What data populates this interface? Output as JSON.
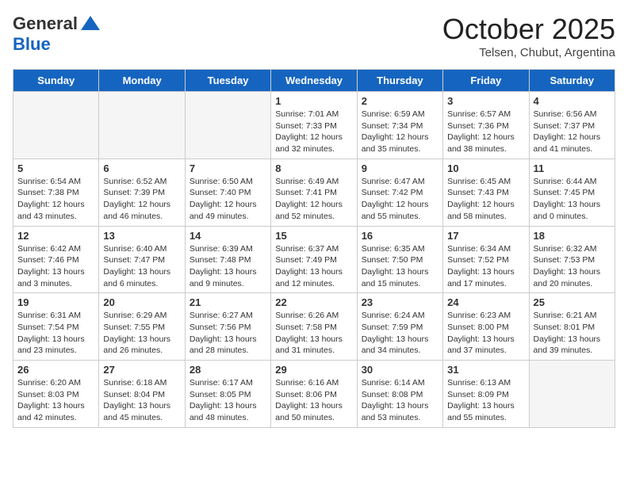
{
  "header": {
    "logo_general": "General",
    "logo_blue": "Blue",
    "month_title": "October 2025",
    "location": "Telsen, Chubut, Argentina"
  },
  "days_of_week": [
    "Sunday",
    "Monday",
    "Tuesday",
    "Wednesday",
    "Thursday",
    "Friday",
    "Saturday"
  ],
  "weeks": [
    [
      {
        "num": "",
        "info": "",
        "empty": true
      },
      {
        "num": "",
        "info": "",
        "empty": true
      },
      {
        "num": "",
        "info": "",
        "empty": true
      },
      {
        "num": "1",
        "info": "Sunrise: 7:01 AM\nSunset: 7:33 PM\nDaylight: 12 hours\nand 32 minutes.",
        "empty": false
      },
      {
        "num": "2",
        "info": "Sunrise: 6:59 AM\nSunset: 7:34 PM\nDaylight: 12 hours\nand 35 minutes.",
        "empty": false
      },
      {
        "num": "3",
        "info": "Sunrise: 6:57 AM\nSunset: 7:36 PM\nDaylight: 12 hours\nand 38 minutes.",
        "empty": false
      },
      {
        "num": "4",
        "info": "Sunrise: 6:56 AM\nSunset: 7:37 PM\nDaylight: 12 hours\nand 41 minutes.",
        "empty": false
      }
    ],
    [
      {
        "num": "5",
        "info": "Sunrise: 6:54 AM\nSunset: 7:38 PM\nDaylight: 12 hours\nand 43 minutes.",
        "empty": false
      },
      {
        "num": "6",
        "info": "Sunrise: 6:52 AM\nSunset: 7:39 PM\nDaylight: 12 hours\nand 46 minutes.",
        "empty": false
      },
      {
        "num": "7",
        "info": "Sunrise: 6:50 AM\nSunset: 7:40 PM\nDaylight: 12 hours\nand 49 minutes.",
        "empty": false
      },
      {
        "num": "8",
        "info": "Sunrise: 6:49 AM\nSunset: 7:41 PM\nDaylight: 12 hours\nand 52 minutes.",
        "empty": false
      },
      {
        "num": "9",
        "info": "Sunrise: 6:47 AM\nSunset: 7:42 PM\nDaylight: 12 hours\nand 55 minutes.",
        "empty": false
      },
      {
        "num": "10",
        "info": "Sunrise: 6:45 AM\nSunset: 7:43 PM\nDaylight: 12 hours\nand 58 minutes.",
        "empty": false
      },
      {
        "num": "11",
        "info": "Sunrise: 6:44 AM\nSunset: 7:45 PM\nDaylight: 13 hours\nand 0 minutes.",
        "empty": false
      }
    ],
    [
      {
        "num": "12",
        "info": "Sunrise: 6:42 AM\nSunset: 7:46 PM\nDaylight: 13 hours\nand 3 minutes.",
        "empty": false
      },
      {
        "num": "13",
        "info": "Sunrise: 6:40 AM\nSunset: 7:47 PM\nDaylight: 13 hours\nand 6 minutes.",
        "empty": false
      },
      {
        "num": "14",
        "info": "Sunrise: 6:39 AM\nSunset: 7:48 PM\nDaylight: 13 hours\nand 9 minutes.",
        "empty": false
      },
      {
        "num": "15",
        "info": "Sunrise: 6:37 AM\nSunset: 7:49 PM\nDaylight: 13 hours\nand 12 minutes.",
        "empty": false
      },
      {
        "num": "16",
        "info": "Sunrise: 6:35 AM\nSunset: 7:50 PM\nDaylight: 13 hours\nand 15 minutes.",
        "empty": false
      },
      {
        "num": "17",
        "info": "Sunrise: 6:34 AM\nSunset: 7:52 PM\nDaylight: 13 hours\nand 17 minutes.",
        "empty": false
      },
      {
        "num": "18",
        "info": "Sunrise: 6:32 AM\nSunset: 7:53 PM\nDaylight: 13 hours\nand 20 minutes.",
        "empty": false
      }
    ],
    [
      {
        "num": "19",
        "info": "Sunrise: 6:31 AM\nSunset: 7:54 PM\nDaylight: 13 hours\nand 23 minutes.",
        "empty": false
      },
      {
        "num": "20",
        "info": "Sunrise: 6:29 AM\nSunset: 7:55 PM\nDaylight: 13 hours\nand 26 minutes.",
        "empty": false
      },
      {
        "num": "21",
        "info": "Sunrise: 6:27 AM\nSunset: 7:56 PM\nDaylight: 13 hours\nand 28 minutes.",
        "empty": false
      },
      {
        "num": "22",
        "info": "Sunrise: 6:26 AM\nSunset: 7:58 PM\nDaylight: 13 hours\nand 31 minutes.",
        "empty": false
      },
      {
        "num": "23",
        "info": "Sunrise: 6:24 AM\nSunset: 7:59 PM\nDaylight: 13 hours\nand 34 minutes.",
        "empty": false
      },
      {
        "num": "24",
        "info": "Sunrise: 6:23 AM\nSunset: 8:00 PM\nDaylight: 13 hours\nand 37 minutes.",
        "empty": false
      },
      {
        "num": "25",
        "info": "Sunrise: 6:21 AM\nSunset: 8:01 PM\nDaylight: 13 hours\nand 39 minutes.",
        "empty": false
      }
    ],
    [
      {
        "num": "26",
        "info": "Sunrise: 6:20 AM\nSunset: 8:03 PM\nDaylight: 13 hours\nand 42 minutes.",
        "empty": false
      },
      {
        "num": "27",
        "info": "Sunrise: 6:18 AM\nSunset: 8:04 PM\nDaylight: 13 hours\nand 45 minutes.",
        "empty": false
      },
      {
        "num": "28",
        "info": "Sunrise: 6:17 AM\nSunset: 8:05 PM\nDaylight: 13 hours\nand 48 minutes.",
        "empty": false
      },
      {
        "num": "29",
        "info": "Sunrise: 6:16 AM\nSunset: 8:06 PM\nDaylight: 13 hours\nand 50 minutes.",
        "empty": false
      },
      {
        "num": "30",
        "info": "Sunrise: 6:14 AM\nSunset: 8:08 PM\nDaylight: 13 hours\nand 53 minutes.",
        "empty": false
      },
      {
        "num": "31",
        "info": "Sunrise: 6:13 AM\nSunset: 8:09 PM\nDaylight: 13 hours\nand 55 minutes.",
        "empty": false
      },
      {
        "num": "",
        "info": "",
        "empty": true
      }
    ]
  ]
}
